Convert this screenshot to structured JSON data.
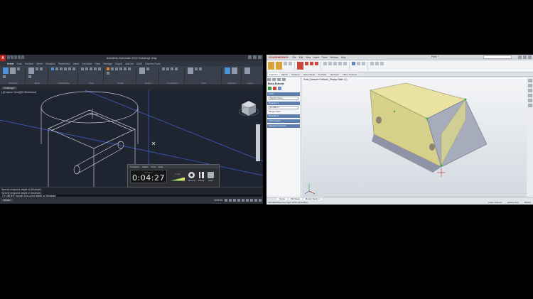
{
  "left_app": {
    "title": "Autodesk AutoCAD 2015  Drawing1.dwg",
    "logo": "A",
    "tabs": [
      "Home",
      "Solid",
      "Surface",
      "Mesh",
      "Visualize",
      "Parametric",
      "Insert",
      "Annotate",
      "View",
      "Manage",
      "Output",
      "Add-ins",
      "A360",
      "Express Tools"
    ],
    "ribbon_groups": [
      "Modeling",
      "Mesh",
      "Solid Editing",
      "Draw",
      "Modify",
      "Section",
      "Coordinates",
      "View",
      "Selection",
      "Layers"
    ],
    "file_tab": "Drawing1*",
    "viewport_label": "[-][Custom View][3D Wireframe]",
    "command_lines": [
      "Specify endpoint height or [Multiple]:",
      "Specify endpoint height or [Multiple]:"
    ],
    "command_prompt": "CYLINDER Specify end-point height or [Multiple]:",
    "layout_tab": "Model",
    "status_right": "MODEL"
  },
  "timer": {
    "menu": [
      "Configure",
      "Status",
      "Time",
      "Help"
    ],
    "clock_label": "Duration",
    "time": "0:04:27",
    "audio_label": "Audio",
    "buttons": [
      {
        "label": "Record",
        "icon": "record-icon"
      },
      {
        "label": "Pause",
        "icon": "pause-icon"
      },
      {
        "label": "Stop",
        "icon": "stop-icon"
      }
    ]
  },
  "right_app": {
    "brand": "SOLIDWORKS",
    "menus": [
      "File",
      "Edit",
      "View",
      "Insert",
      "Tools",
      "Window",
      "Help"
    ],
    "doc_title": "Part1 *",
    "tabs": [
      "Features",
      "Sketch",
      "Surfaces",
      "Sheet Metal",
      "Evaluate",
      "DimXpert",
      "Office Products"
    ],
    "tree_item": "Part1 (Default<<Default>_Display State 1>)",
    "panel": {
      "title": "Boss-Extrude",
      "sections": [
        "From",
        "Direction 1",
        "Direction 2",
        "Thin Feature",
        "Selected Contours"
      ],
      "from_value": "Sketch Plane",
      "depth_value": "10.00mm",
      "checkbox": "Merge result"
    },
    "bottom_tabs": [
      "Model",
      "3D Views",
      "Motion Study 1"
    ],
    "status": [
      "SOLIDWORKS Premium 2015 x64 Edition"
    ],
    "status_right": [
      "Under Defined",
      "Editing Part",
      "MMGS"
    ]
  },
  "colors": {
    "acad_bg": "#1e2430",
    "acad_wire": "#c9ccd6",
    "acad_axis": "#3f63d9",
    "sw_top_face": "#e9e2a3",
    "sw_front_face": "#d6d08a",
    "sw_side_face": "#a7acbd",
    "sw_highlight": "#f2ea74"
  }
}
